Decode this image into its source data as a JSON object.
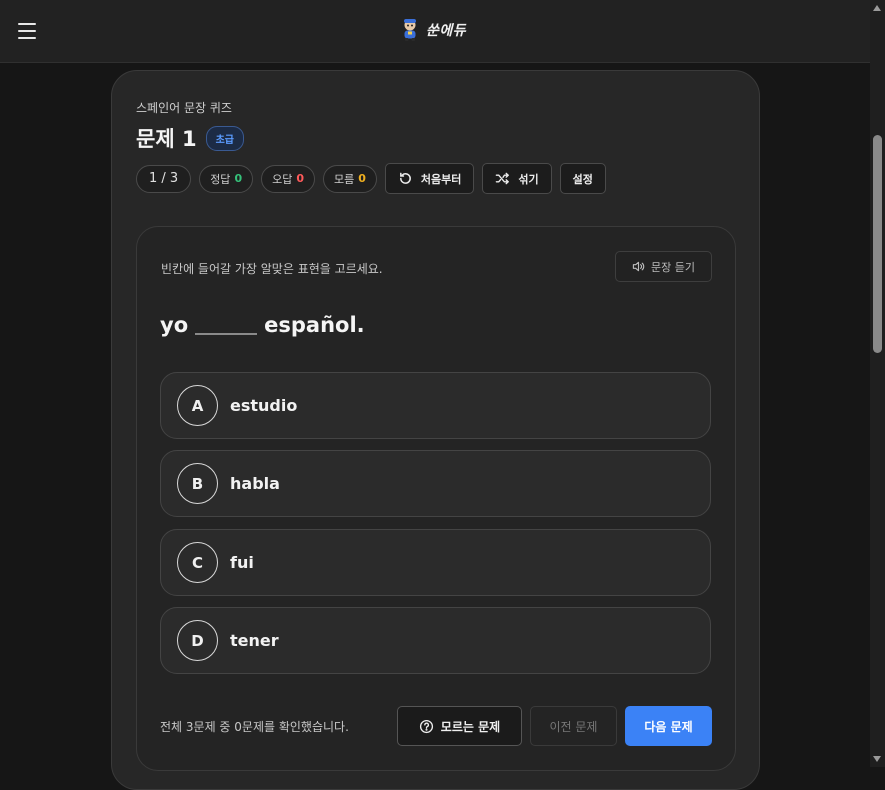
{
  "header": {
    "logo_text": "쑨에듀",
    "menu_icon": "hamburger-menu-icon",
    "logo_icon": "mascot-logo-icon"
  },
  "quiz": {
    "subtitle": "스페인어 문장 퀴즈",
    "title": "문제 1",
    "level": "초급",
    "progress": "1 / 3",
    "stats": {
      "correct_label": "정답",
      "correct_value": "0",
      "wrong_label": "오답",
      "wrong_value": "0",
      "unknown_label": "모름",
      "unknown_value": "0"
    },
    "tools": {
      "restart_label": "처음부터",
      "shuffle_label": "섞기",
      "settings_label": "설정"
    }
  },
  "question": {
    "instruction": "빈칸에 들어갈 가장 알맞은 표현을 고르세요.",
    "listen_label": "문장 듣기",
    "sentence_before": "yo",
    "sentence_after": "español.",
    "options": [
      {
        "letter": "A",
        "text": "estudio"
      },
      {
        "letter": "B",
        "text": "habla"
      },
      {
        "letter": "C",
        "text": "fui"
      },
      {
        "letter": "D",
        "text": "tener"
      }
    ],
    "footer_text": "전체 3문제 중 0문제를 확인했습니다.",
    "unknown_button": "모르는 문제",
    "prev_button": "이전 문제",
    "next_button": "다음 문제"
  },
  "colors": {
    "accent": "#3b82f6",
    "correct": "#35c27a",
    "wrong": "#ff5a5a",
    "unknown": "#f0b020",
    "level_badge": "#5b9cff"
  }
}
